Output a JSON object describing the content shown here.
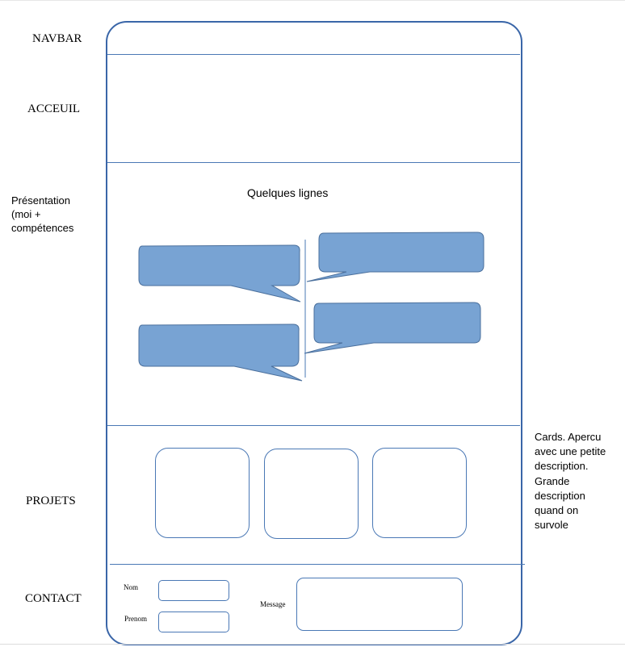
{
  "sections": {
    "navbar": "NAVBAR",
    "accueil": "ACCEUIL",
    "presentation": [
      "Présentation",
      "(moi +",
      "compétences"
    ],
    "projets": "PROJETS",
    "contact": "CONTACT"
  },
  "presentation_block": {
    "heading": "Quelques lignes"
  },
  "cards_note": [
    "Cards. Apercu",
    "avec une petite",
    "description.",
    "Grande",
    "description",
    "quand on",
    "survole"
  ],
  "contact_form": {
    "nom_label": "Nom",
    "prenom_label": "Prenom",
    "message_label": "Message"
  },
  "colors": {
    "frame": "#3a66a8",
    "bubble_fill": "#78a3d3",
    "bubble_stroke": "#4a6f9c"
  }
}
